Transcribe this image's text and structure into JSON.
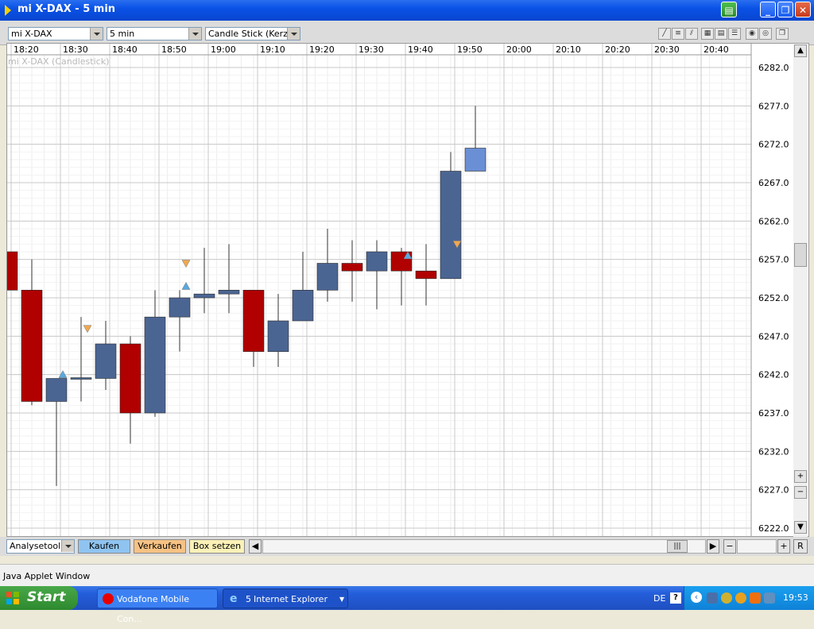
{
  "window": {
    "title": "mi X-DAX - 5 min"
  },
  "toolbar": {
    "instrument": "mi X-DAX",
    "interval": "5 min",
    "chart_type": "Candle Stick (Kerzen"
  },
  "chart": {
    "label": "mi X-DAX (Candlestick)",
    "time_labels": [
      "18:20",
      "18:30",
      "18:40",
      "18:50",
      "19:00",
      "19:10",
      "19:20",
      "19:30",
      "19:40",
      "19:50",
      "20:00",
      "20:10",
      "20:20",
      "20:30",
      "20:40"
    ],
    "price_labels": [
      "6282.0",
      "6277.0",
      "6272.0",
      "6267.0",
      "6262.0",
      "6257.0",
      "6252.0",
      "6247.0",
      "6242.0",
      "6237.0",
      "6232.0",
      "6227.0",
      "6222.0"
    ]
  },
  "chart_data": {
    "type": "candlestick",
    "title": "mi X-DAX (Candlestick)",
    "ylim": [
      6222.0,
      6282.0
    ],
    "x": [
      "18:15",
      "18:20",
      "18:25",
      "18:30",
      "18:35",
      "18:40",
      "18:45",
      "18:50",
      "18:55",
      "19:00",
      "19:05",
      "19:10",
      "19:15",
      "19:20",
      "19:25",
      "19:30",
      "19:35",
      "19:40",
      "19:45",
      "19:50"
    ],
    "candles": [
      {
        "open": 6258.0,
        "high": 6258.0,
        "low": 6253.0,
        "close": 6253.0,
        "color": "#b00000"
      },
      {
        "open": 6253.0,
        "high": 6257.0,
        "low": 6238.0,
        "close": 6238.5,
        "color": "#b00000"
      },
      {
        "open": 6238.5,
        "high": 6241.5,
        "low": 6227.5,
        "close": 6241.5,
        "color": "#4b6593"
      },
      {
        "open": 6241.5,
        "high": 6249.5,
        "low": 6238.5,
        "close": 6241.6,
        "color": "#4b6593"
      },
      {
        "open": 6241.5,
        "high": 6249.0,
        "low": 6240.0,
        "close": 6246.0,
        "color": "#4b6593"
      },
      {
        "open": 6246.0,
        "high": 6247.0,
        "low": 6233.0,
        "close": 6237.0,
        "color": "#b00000"
      },
      {
        "open": 6237.0,
        "high": 6253.0,
        "low": 6236.5,
        "close": 6249.5,
        "color": "#4b6593"
      },
      {
        "open": 6249.5,
        "high": 6253.0,
        "low": 6245.0,
        "close": 6252.0,
        "color": "#4b6593"
      },
      {
        "open": 6252.0,
        "high": 6258.5,
        "low": 6250.0,
        "close": 6252.5,
        "color": "#4b6593"
      },
      {
        "open": 6252.5,
        "high": 6259.0,
        "low": 6250.0,
        "close": 6253.0,
        "color": "#4b6593"
      },
      {
        "open": 6253.0,
        "high": 6253.0,
        "low": 6243.0,
        "close": 6245.0,
        "color": "#b00000"
      },
      {
        "open": 6245.0,
        "high": 6252.5,
        "low": 6243.0,
        "close": 6249.0,
        "color": "#4b6593"
      },
      {
        "open": 6249.0,
        "high": 6258.0,
        "low": 6249.0,
        "close": 6253.0,
        "color": "#4b6593"
      },
      {
        "open": 6253.0,
        "high": 6261.0,
        "low": 6251.5,
        "close": 6256.5,
        "color": "#4b6593"
      },
      {
        "open": 6256.5,
        "high": 6259.5,
        "low": 6251.5,
        "close": 6255.5,
        "color": "#b00000"
      },
      {
        "open": 6255.5,
        "high": 6259.5,
        "low": 6250.5,
        "close": 6258.0,
        "color": "#4b6593"
      },
      {
        "open": 6258.0,
        "high": 6258.5,
        "low": 6251.0,
        "close": 6255.5,
        "color": "#b00000"
      },
      {
        "open": 6255.5,
        "high": 6259.0,
        "low": 6251.0,
        "close": 6254.5,
        "color": "#b00000"
      },
      {
        "open": 6254.5,
        "high": 6271.0,
        "low": 6254.5,
        "close": 6268.5,
        "color": "#4b6593"
      },
      {
        "open": 6268.5,
        "high": 6277.0,
        "low": 6268.5,
        "close": 6271.5,
        "color": "#6a8fd4"
      }
    ],
    "markers": [
      {
        "x": "18:25",
        "price": 6242.0,
        "kind": "up",
        "color": "#5aa8e0"
      },
      {
        "x": "18:30",
        "price": 6248.0,
        "kind": "down",
        "color": "#f0a850"
      },
      {
        "x": "18:50",
        "price": 6256.5,
        "kind": "down",
        "color": "#f0a850"
      },
      {
        "x": "18:50",
        "price": 6253.5,
        "kind": "up",
        "color": "#5aa8e0"
      },
      {
        "x": "19:35",
        "price": 6257.5,
        "kind": "up",
        "color": "#5aa8e0"
      },
      {
        "x": "19:45",
        "price": 6259.0,
        "kind": "down",
        "color": "#f0a850"
      }
    ]
  },
  "bottombar": {
    "analysetool": "Analysetool",
    "kaufen": "Kaufen",
    "verkaufen": "Verkaufen",
    "box_setzen": "Box setzen",
    "reset": "R"
  },
  "status": {
    "text": "Java Applet Window"
  },
  "taskbar": {
    "start": "Start",
    "task1": "Vodafone Mobile Con...",
    "task2_count": "5",
    "task2": "Internet Explorer",
    "lang": "DE",
    "time": "19:53"
  }
}
